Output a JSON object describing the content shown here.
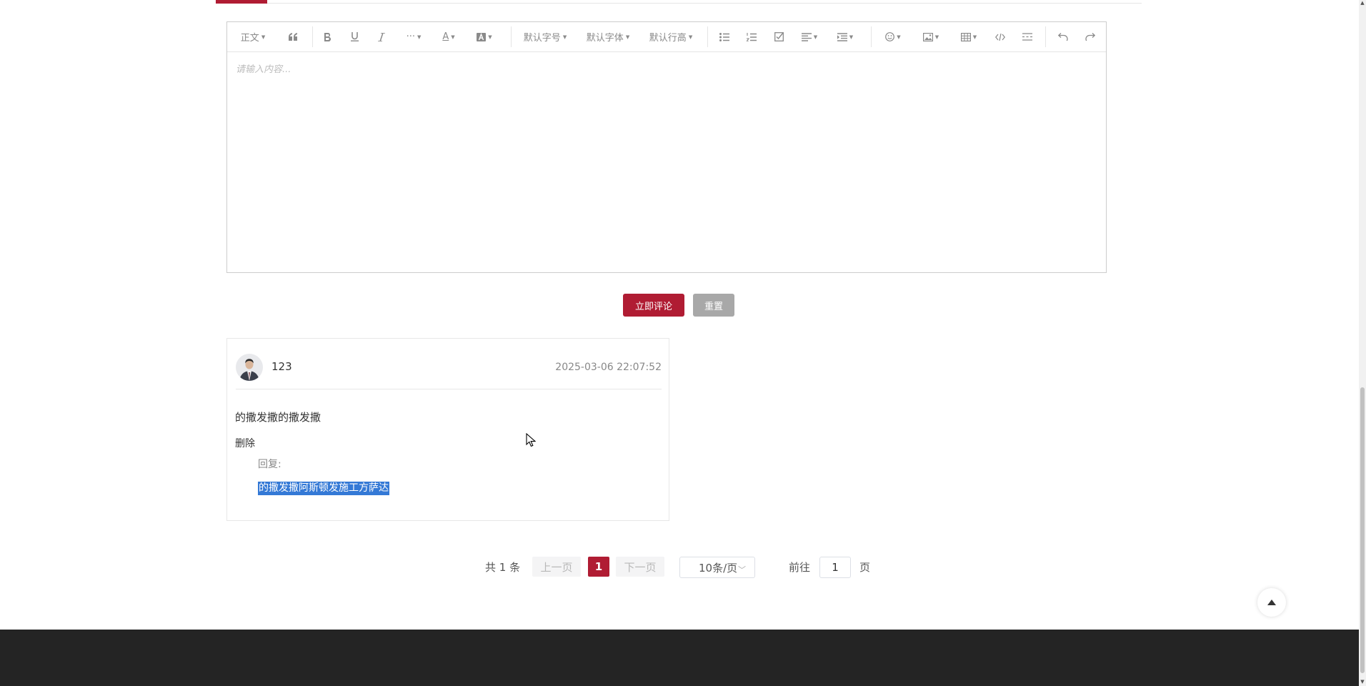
{
  "toolbar": {
    "paragraph_label": "正文",
    "font_size_label": "默认字号",
    "font_family_label": "默认字体",
    "line_height_label": "默认行高",
    "more_label": "···",
    "font_color_label": "A"
  },
  "editor": {
    "placeholder": "请输入内容..."
  },
  "actions": {
    "submit_label": "立即评论",
    "reset_label": "重置"
  },
  "comment": {
    "username": "123",
    "time": "2025-03-06 22:07:52",
    "content": "的撒发撒的撒发撒",
    "delete_label": "删除",
    "reply_label": "回复:",
    "reply_content": "的撒发撒阿斯顿发施工方萨达"
  },
  "pagination": {
    "total_label": "共 1 条",
    "prev_label": "上一页",
    "current_page": "1",
    "next_label": "下一页",
    "page_size_label": "10条/页",
    "goto_label": "前往",
    "goto_value": "1",
    "page_suffix": "页"
  },
  "colors": {
    "accent": "#b01c33",
    "reset": "#a8a8a8",
    "footer": "#242424",
    "selection": "#3479d6"
  }
}
